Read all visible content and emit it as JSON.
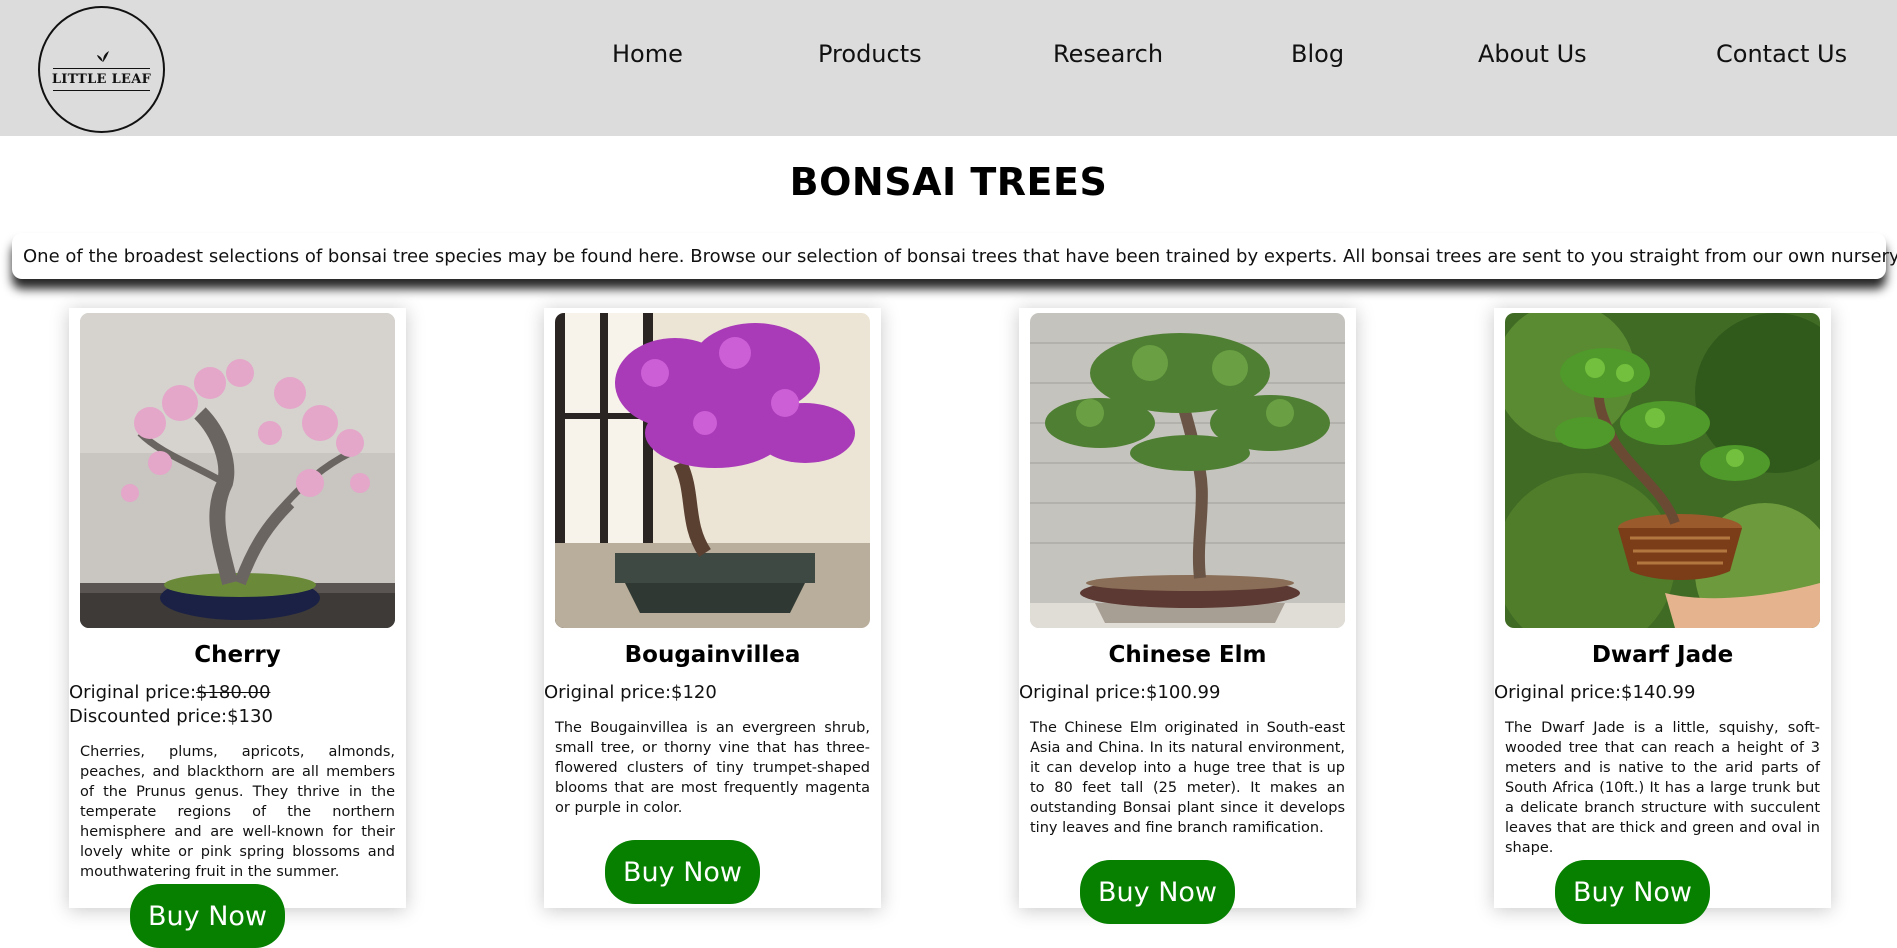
{
  "logo": {
    "text": "LITTLE LEAF"
  },
  "nav": {
    "home": "Home",
    "products": "Products",
    "research": "Research",
    "blog": "Blog",
    "about": "About Us",
    "contact": "Contact Us"
  },
  "page": {
    "title": "BONSAI TREES",
    "intro": "One of the broadest selections of bonsai tree species may be found here. Browse our selection of bonsai trees that have been trained by experts. All bonsai trees are sent to you straight from our own nursery."
  },
  "colors": {
    "header_bg": "#dcdcdc",
    "buy_button": "#078000"
  },
  "products": [
    {
      "name": "Cherry",
      "original_label": "Original price:",
      "original_price": "$180.00",
      "discount_label": "Discounted price:",
      "discount_price": "$130",
      "description": "Cherries, plums, apricots, almonds, peaches, and blackthorn are all members of the Prunus genus. They thrive in the temperate regions of the northern hemisphere and are well-known for their lovely white or pink spring blossoms and mouthwatering fruit in the summer.",
      "button": "Buy Now"
    },
    {
      "name": "Bougainvillea",
      "original_label": "Original price:",
      "original_price": "$120",
      "description": "The Bougainvillea is an evergreen shrub, small tree, or thorny vine that has three-flowered clusters of tiny trumpet-shaped blooms that are most frequently magenta or purple in color.",
      "button": "Buy Now"
    },
    {
      "name": "Chinese Elm",
      "original_label": "Original price:",
      "original_price": "$100.99",
      "description": "The Chinese Elm originated in South-east Asia and China. In its natural environment, it can develop into a huge tree that is up to 80 feet tall (25 meter). It makes an outstanding Bonsai plant since it develops tiny leaves and fine branch ramification.",
      "button": "Buy Now"
    },
    {
      "name": "Dwarf Jade",
      "original_label": "Original price:",
      "original_price": "$140.99",
      "description": "The Dwarf Jade is a little, squishy, soft-wooded tree that can reach a height of 3 meters and is native to the arid parts of South Africa (10ft.) It has a large trunk but a delicate branch structure with succulent leaves that are thick and green and oval in shape.",
      "button": "Buy Now"
    }
  ]
}
